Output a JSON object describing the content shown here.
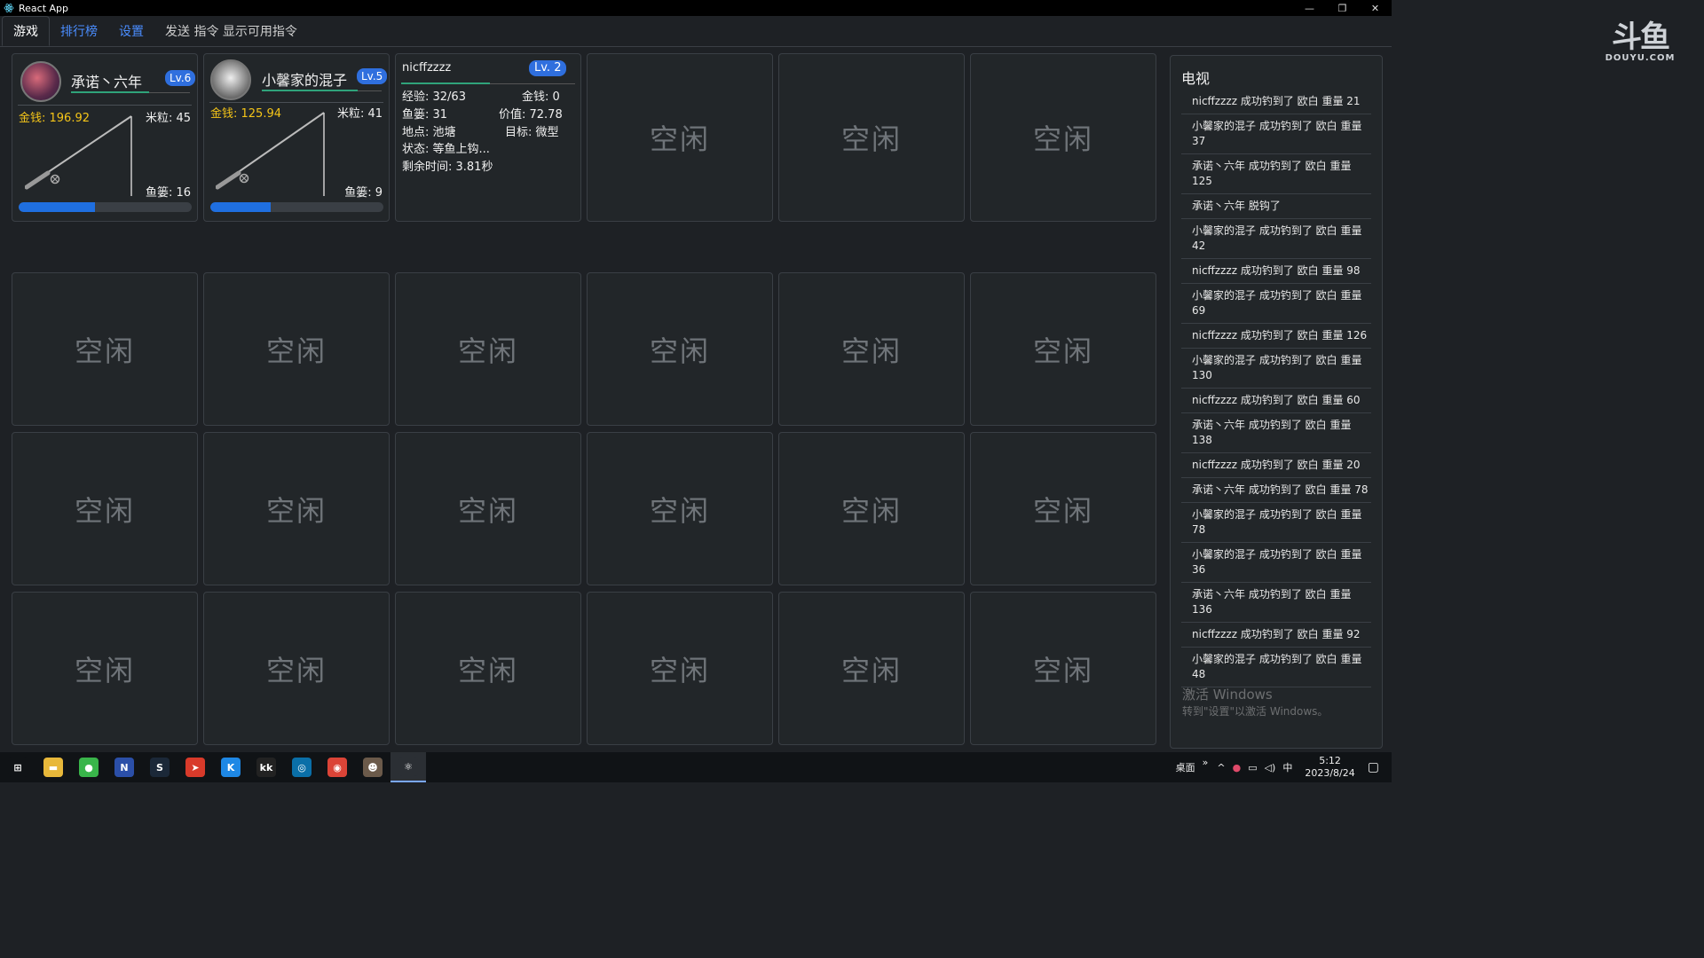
{
  "window": {
    "title": "React App"
  },
  "window_controls": {
    "minimize": "—",
    "restore": "❐",
    "close": "✕"
  },
  "tabs": [
    {
      "label": "游戏",
      "active": true
    },
    {
      "label": "排行榜"
    },
    {
      "label": "设置"
    },
    {
      "label": "发送 指令 显示可用指令"
    }
  ],
  "logo": {
    "main": "斗鱼",
    "sub": "DOUYU.COM"
  },
  "players": [
    {
      "name": "承诺丶六年",
      "level": "Lv.6",
      "money": "金钱: 196.92",
      "rice": "米粒: 45",
      "fish": "鱼篓: 16",
      "progress": 0.44
    },
    {
      "name": "小馨家的混子",
      "level": "Lv.5",
      "money": "金钱: 125.94",
      "rice": "米粒: 41",
      "fish": "鱼篓: 9",
      "progress": 0.35
    }
  ],
  "detail_card": {
    "name": "nicffzzzz",
    "level": "Lv. 2",
    "xp": "经验: 32/63",
    "money": "金钱: 0",
    "fish": "鱼篓: 31",
    "value": "价值: 72.78",
    "location": "地点: 池塘",
    "target": "目标: 微型",
    "status": "状态: 等鱼上钩...",
    "time_left": "剩余时间: 3.81秒",
    "xp_progress": 0.51
  },
  "idle_label": "空闲",
  "tv": {
    "title": "电视",
    "items": [
      "nicffzzzz 成功钓到了 欧白 重量 21",
      "小馨家的混子 成功钓到了 欧白 重量 37",
      "承诺丶六年 成功钓到了 欧白 重量 125",
      "承诺丶六年 脱钩了",
      "小馨家的混子 成功钓到了 欧白 重量 42",
      "nicffzzzz 成功钓到了 欧白 重量 98",
      "小馨家的混子 成功钓到了 欧白 重量 69",
      "nicffzzzz 成功钓到了 欧白 重量 126",
      "小馨家的混子 成功钓到了 欧白 重量 130",
      "nicffzzzz 成功钓到了 欧白 重量 60",
      "承诺丶六年 成功钓到了 欧白 重量 138",
      "nicffzzzz 成功钓到了 欧白 重量 20",
      "承诺丶六年 成功钓到了 欧白 重量 78",
      "小馨家的混子 成功钓到了 欧白 重量 78",
      "小馨家的混子 成功钓到了 欧白 重量 36",
      "承诺丶六年 成功钓到了 欧白 重量 136",
      "nicffzzzz 成功钓到了 欧白 重量 92",
      "小馨家的混子 成功钓到了 欧白 重量 48"
    ]
  },
  "watermark": {
    "line1": "激活 Windows",
    "line2": "转到\"设置\"以激活 Windows。"
  },
  "taskbar": {
    "apps": [
      {
        "name": "start-icon",
        "glyph": "⊞",
        "color": "#101316"
      },
      {
        "name": "file-explorer-icon",
        "glyph": "▬",
        "color": "#e8b83a"
      },
      {
        "name": "chat-app-icon",
        "glyph": "●",
        "color": "#39b54a"
      },
      {
        "name": "editor-app-icon",
        "glyph": "N",
        "color": "#2b4fa8"
      },
      {
        "name": "steam-icon",
        "glyph": "S",
        "color": "#1b2838"
      },
      {
        "name": "browser-red-icon",
        "glyph": "➤",
        "color": "#d83a2a"
      },
      {
        "name": "k-app-icon",
        "glyph": "K",
        "color": "#1e88e5"
      },
      {
        "name": "kk-app-icon",
        "glyph": "kk",
        "color": "#222"
      },
      {
        "name": "circle-app-icon",
        "glyph": "◎",
        "color": "#0a6fa8"
      },
      {
        "name": "chrome-icon",
        "glyph": "◉",
        "color": "#db4437"
      },
      {
        "name": "avatar-app-icon",
        "glyph": "☻",
        "color": "#6b5a4a"
      },
      {
        "name": "react-app-icon",
        "glyph": "⚛",
        "color": "#2b2f34"
      }
    ],
    "tray_desktop": "桌面",
    "tray_chevron": "»",
    "tray_up": "^",
    "tray_ime": "中",
    "time": "5:12",
    "date": "2023/8/24"
  }
}
